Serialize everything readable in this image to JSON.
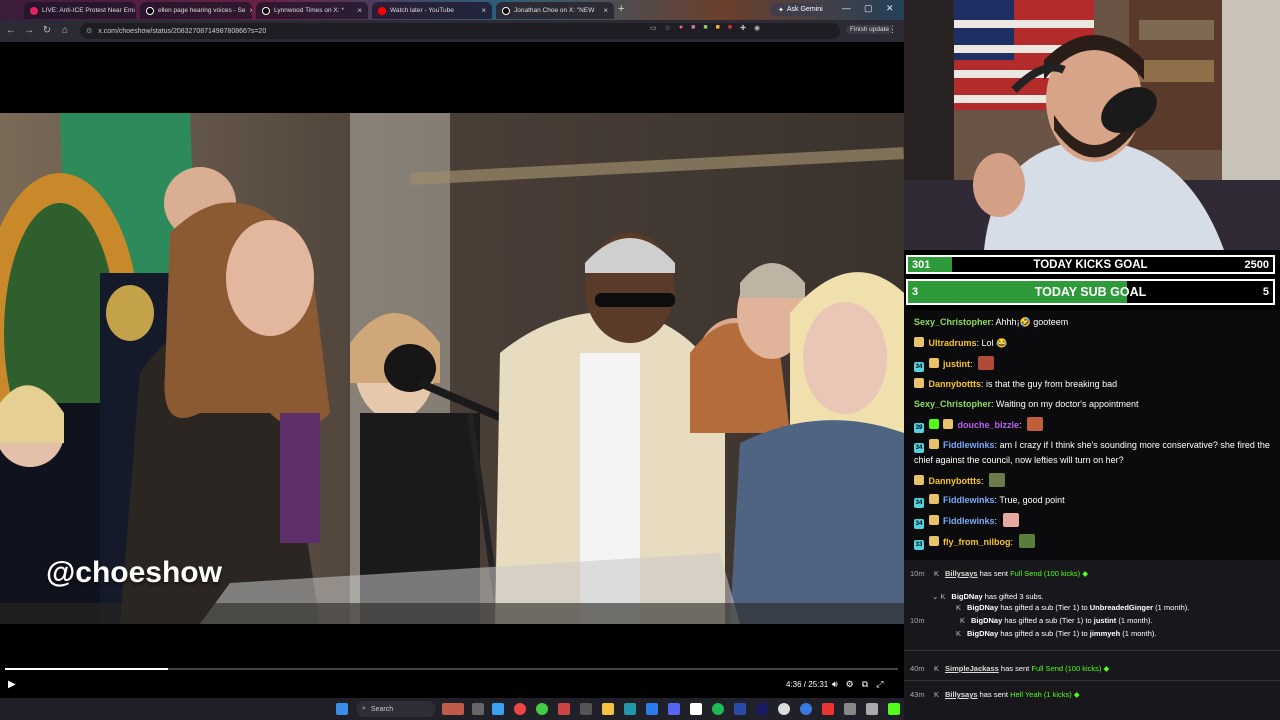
{
  "browser": {
    "tabs": [
      {
        "label": "LIVE: Anti-ICE Protest Near Emi",
        "color": "#e0245e"
      },
      {
        "label": "ellen page hearing voices - Se",
        "color": "#ffffff"
      },
      {
        "label": "Lynnwood Times on X: *",
        "color": "#ffffff"
      },
      {
        "label": "Watch later - YouTube",
        "color": "#ff0000"
      },
      {
        "label": "Jonathan Choe on X: \"NEW",
        "color": "#ffffff"
      }
    ],
    "ask_gemini": "Ask Gemini",
    "url": "x.com/choeshow/status/2083270871498780866?s=20",
    "finish_update": "Finish update"
  },
  "video": {
    "watermark": "@choeshow",
    "time": "4:36 / 25:31",
    "progress": 0.183
  },
  "goals": {
    "kicks": {
      "current": "301",
      "label": "TODAY KICKS GOAL",
      "target": "2500",
      "fraction": 0.12
    },
    "subs": {
      "current": "3",
      "label": "TODAY SUB GOAL",
      "target": "5",
      "fraction": 0.6
    }
  },
  "chat": [
    {
      "badges": [],
      "user": "Sexy_Christopher",
      "color": "#8ddc5c",
      "text": "Ahhh¡🤣 gooteem"
    },
    {
      "badges": [
        "sub"
      ],
      "user": "Ultradrums",
      "color": "#f7c52b",
      "text": "Lol 😂"
    },
    {
      "badges": [
        "34",
        "sub"
      ],
      "user": "justint",
      "color": "#f7c52b",
      "text": ""
    },
    {
      "badges": [
        "sub"
      ],
      "user": "Dannybottts",
      "color": "#f7c52b",
      "text": "is that the guy from breaking bad"
    },
    {
      "badges": [],
      "user": "Sexy_Christopher",
      "color": "#8ddc5c",
      "text": "Waiting on my doctor's appointment"
    },
    {
      "badges": [
        "39",
        "gift",
        "sub"
      ],
      "user": "douche_bizzle",
      "color": "#c05cf0",
      "text": ""
    },
    {
      "badges": [
        "34",
        "sub"
      ],
      "user": "Fiddlewinks",
      "color": "#7aa9f7",
      "text": "am I crazy if I think she's sounding more conservative? she fired the chief against the council, now lefties will turn on her?"
    },
    {
      "badges": [
        "sub"
      ],
      "user": "Dannybottts",
      "color": "#f7c52b",
      "text": ""
    },
    {
      "badges": [
        "34",
        "sub"
      ],
      "user": "Fiddlewinks",
      "color": "#7aa9f7",
      "text": "True, good point"
    },
    {
      "badges": [
        "34",
        "sub"
      ],
      "user": "Fiddlewinks",
      "color": "#7aa9f7",
      "text": ""
    },
    {
      "badges": [
        "33",
        "sub"
      ],
      "user": "fly_from_nilbog",
      "color": "#f7c52b",
      "text": ""
    }
  ],
  "events": [
    {
      "time": "10m",
      "user": "Billysays",
      "mid": "has sent",
      "green": "Full Send (100 kicks)"
    },
    {
      "time": "",
      "user": "BigDNay",
      "mid": "has gifted 3 subs.",
      "green": ""
    },
    {
      "time": "",
      "user": "BigDNay",
      "mid": "has gifted a sub (Tier 1) to",
      "target": "UnbreadedGinger",
      "tail": "(1 month)."
    },
    {
      "time": "10m",
      "user": "BigDNay",
      "mid": "has gifted a sub (Tier 1) to",
      "target": "justint",
      "tail": "(1 month)."
    },
    {
      "time": "",
      "user": "BigDNay",
      "mid": "has gifted a sub (Tier 1) to",
      "target": "jimmyeh",
      "tail": "(1 month)."
    },
    {
      "time": "40m",
      "user": "SimpleJackass",
      "mid": "has sent",
      "green": "Full Send (100 kicks)"
    },
    {
      "time": "43m",
      "user": "Billysays",
      "mid": "has sent",
      "green": "Hell Yeah (1 kicks)"
    }
  ],
  "taskbar": {
    "search": "Search"
  },
  "icons": [
    "play-icon",
    "volume-icon",
    "settings-icon",
    "pip-icon",
    "fullscreen-icon",
    "windows-start-icon",
    "search-icon",
    "gift-icon",
    "kick-icon"
  ]
}
